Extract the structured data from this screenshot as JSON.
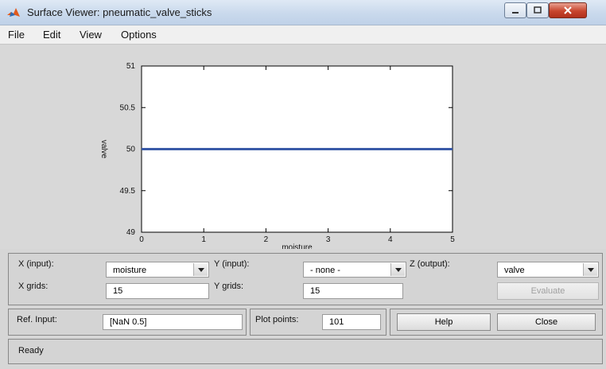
{
  "window": {
    "title": "Surface Viewer: pneumatic_valve_sticks",
    "controls": {
      "minimize": "minimize",
      "maximize": "maximize",
      "close": "close"
    }
  },
  "menu": [
    "File",
    "Edit",
    "View",
    "Options"
  ],
  "chart_data": {
    "type": "line",
    "xlabel": "moisture",
    "ylabel": "valve",
    "xlim": [
      0,
      5
    ],
    "ylim": [
      49,
      51
    ],
    "x_ticks": [
      "0",
      "1",
      "2",
      "3",
      "4",
      "5"
    ],
    "y_ticks": [
      "49",
      "49.5",
      "50",
      "50.5",
      "51"
    ],
    "series": [
      {
        "x": [
          0,
          5
        ],
        "y": [
          50,
          50
        ],
        "color": "#3a5aa8"
      }
    ],
    "grid": false
  },
  "controls": {
    "x_input_label": "X (input):",
    "x_input_value": "moisture",
    "y_input_label": "Y (input):",
    "y_input_value": "- none -",
    "z_output_label": "Z (output):",
    "z_output_value": "valve",
    "x_grids_label": "X grids:",
    "x_grids_value": "15",
    "y_grids_label": "Y grids:",
    "y_grids_value": "15",
    "evaluate_label": "Evaluate",
    "ref_input_label": "Ref. Input:",
    "ref_input_value": "[NaN 0.5]",
    "plot_points_label": "Plot points:",
    "plot_points_value": "101",
    "help_label": "Help",
    "close_label": "Close"
  },
  "status": {
    "text": "Ready"
  }
}
